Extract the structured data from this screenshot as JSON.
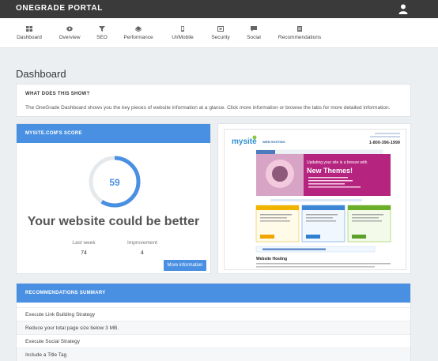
{
  "app": {
    "brand": "ONEGRADE PORTAL"
  },
  "nav": {
    "items": [
      {
        "label": "Dashboard",
        "icon": "dashboard-icon"
      },
      {
        "label": "Overview",
        "icon": "overview-icon"
      },
      {
        "label": "SEO",
        "icon": "seo-icon"
      },
      {
        "label": "Performance",
        "icon": "performance-icon"
      },
      {
        "label": "UI/Mobile",
        "icon": "mobile-icon"
      },
      {
        "label": "Security",
        "icon": "security-icon"
      },
      {
        "label": "Social",
        "icon": "social-icon"
      },
      {
        "label": "Recommendations",
        "icon": "recommendations-icon"
      }
    ]
  },
  "page": {
    "title": "Dashboard"
  },
  "what": {
    "heading": "WHAT DOES THIS SHOW?",
    "text": "The OneGrade Dashboard shows you the key pieces of website information at a glance. Click more information or browse the tabs for more detailed information."
  },
  "score": {
    "heading": "MYSITE.COM'S SCORE",
    "value": "59",
    "fraction": 0.59,
    "verdict": "Your website could be better",
    "last_week_label": "Last week",
    "last_week_value": "74",
    "improvement_label": "Improvement",
    "improvement_value": "4",
    "button_label": "More information"
  },
  "preview": {
    "logo": "mysite",
    "tagline": "WEB HOSTING",
    "phone": "1-800-396-1999",
    "banner_line1": "Updating your site is a breeze with",
    "banner_line2": "New Themes!",
    "section_title": "Website Hosting"
  },
  "recs": {
    "heading": "RECOMMENDATIONS SUMMARY",
    "items": [
      "Execute Link Building Strategy",
      "Reduce your total page size below 3 MB.",
      "Execute Social Strategy",
      "Include a Title Tag"
    ]
  },
  "colors": {
    "accent": "#4a90e2",
    "topbar": "#3a3a3a",
    "background": "#eceff1"
  }
}
